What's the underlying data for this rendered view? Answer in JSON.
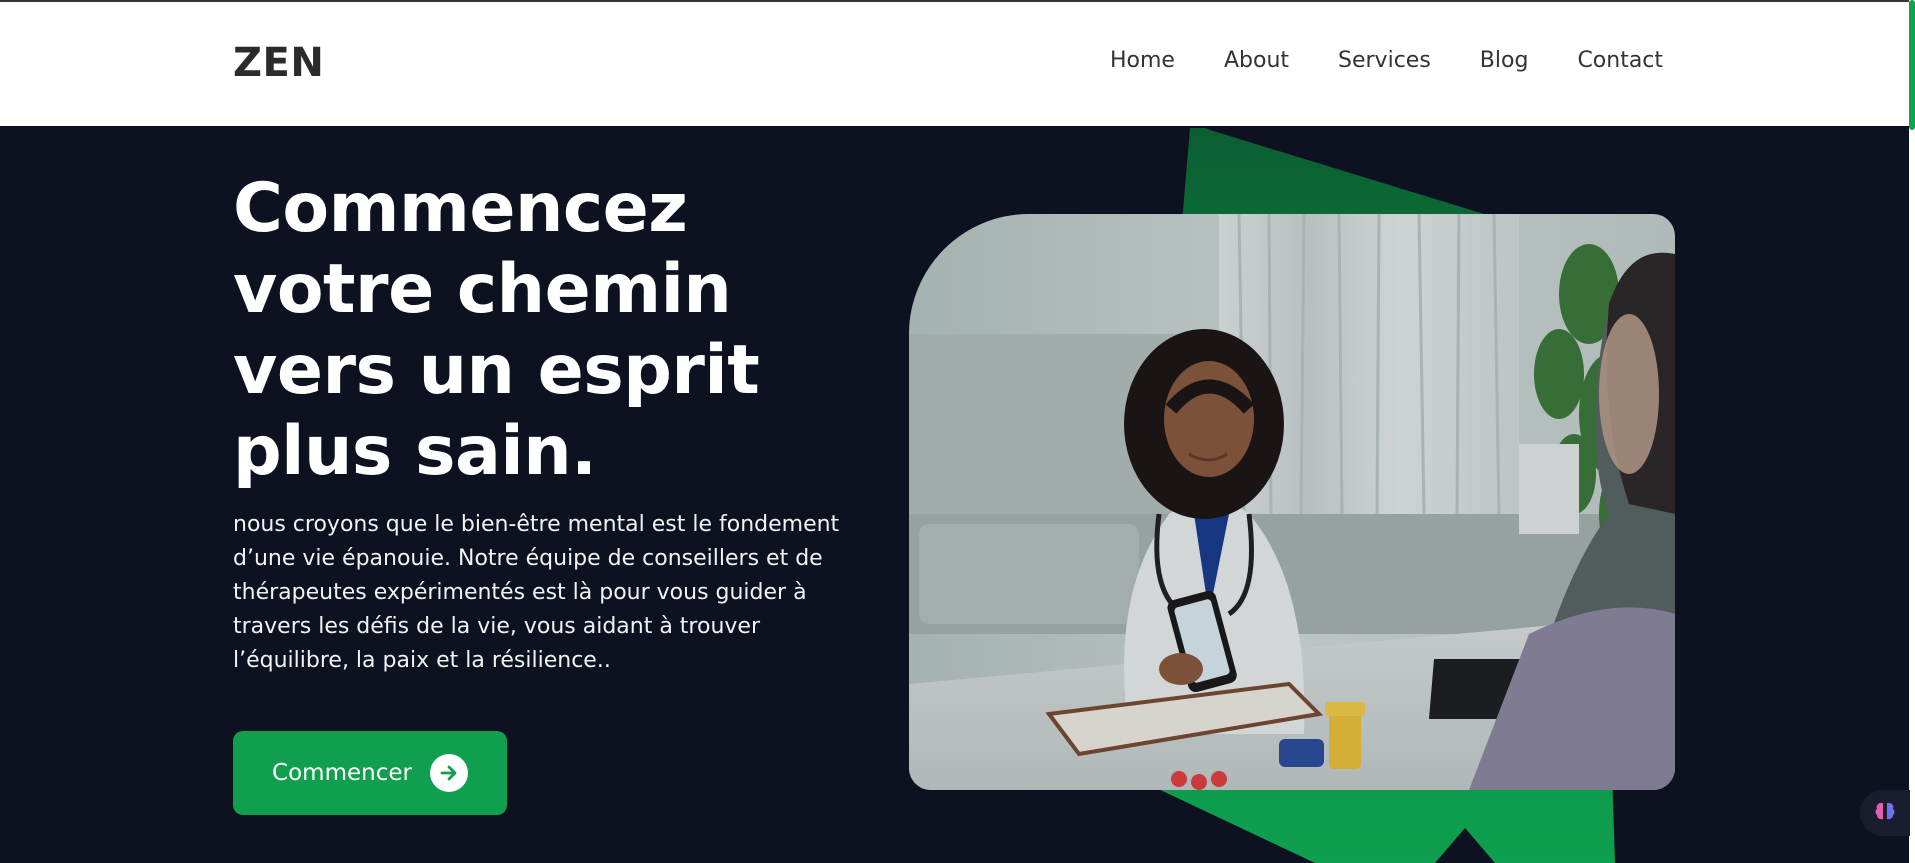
{
  "brand": {
    "name": "ZEN"
  },
  "nav": {
    "items": [
      {
        "label": "Home"
      },
      {
        "label": "About"
      },
      {
        "label": "Services"
      },
      {
        "label": "Blog"
      },
      {
        "label": "Contact"
      }
    ]
  },
  "hero": {
    "title": "Commencez votre chemin vers un esprit plus sain.",
    "description": "nous croyons que le bien-être mental est le fondement d’une vie épanouie. Notre équipe de conseillers et de thérapeutes expérimentés est là pour vous guider à travers les défis de la vie, vous aidant à trouver l’équilibre, la paix et la résilience..",
    "cta_label": "Commencer"
  },
  "colors": {
    "background": "#0e1120",
    "accent": "#0f9f4f",
    "navbar": "#ffffff"
  },
  "icons": {
    "cta": "arrow-right-circle-icon",
    "widget": "brain-icon"
  }
}
